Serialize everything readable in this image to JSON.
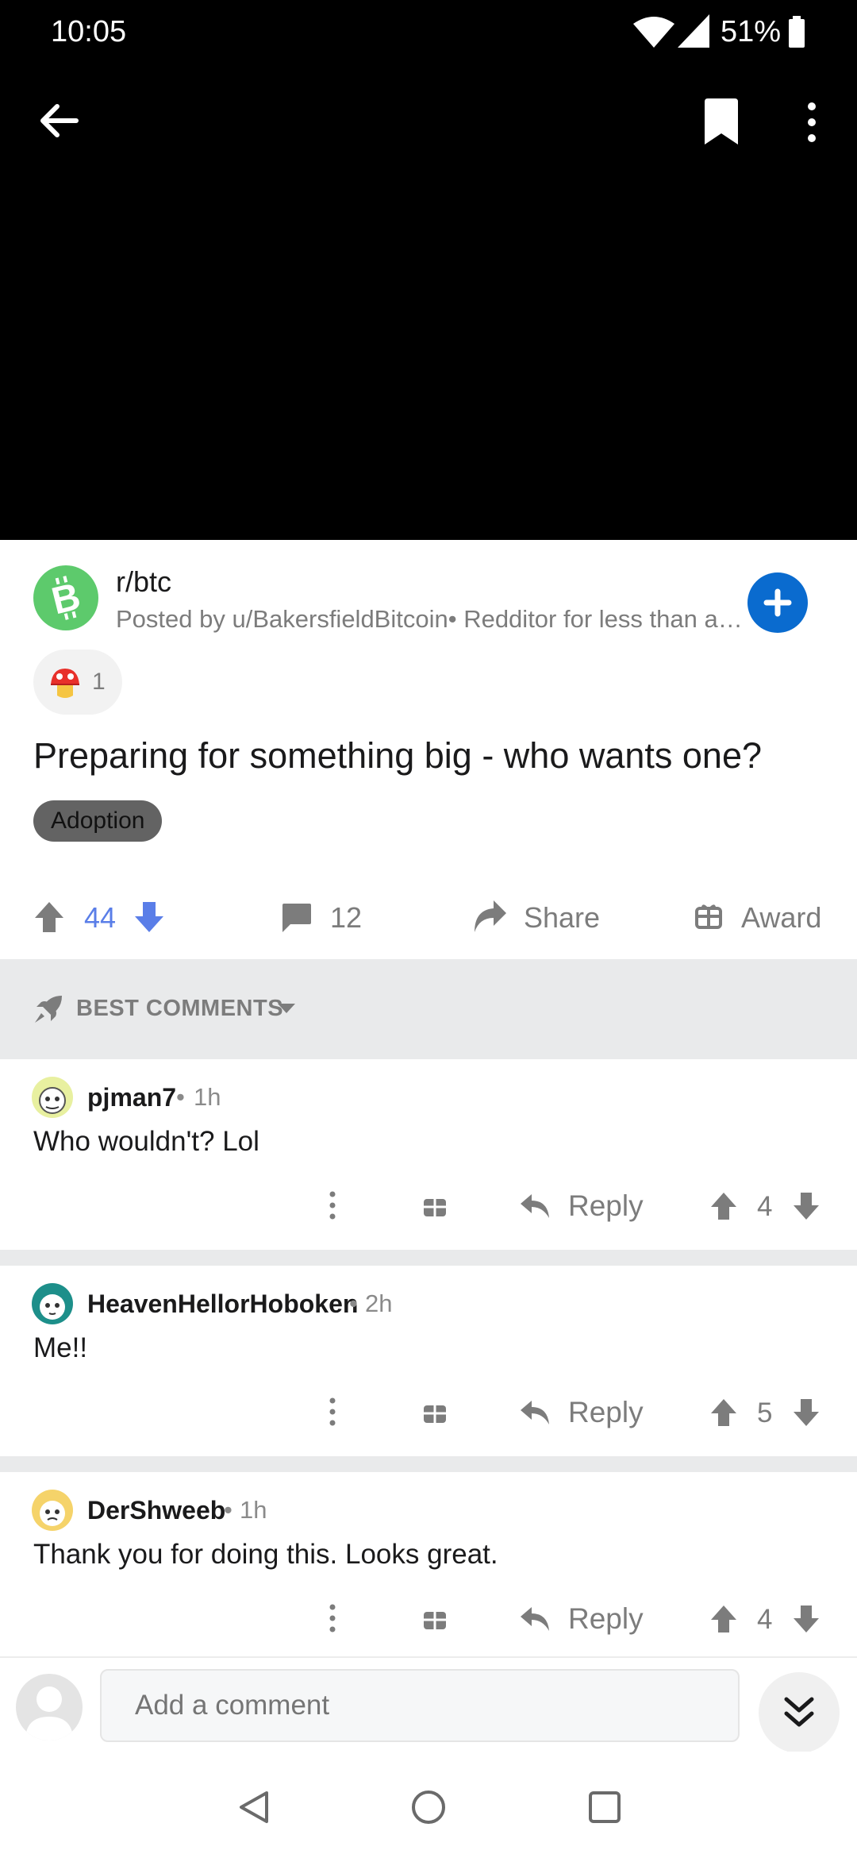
{
  "status_bar": {
    "time": "10:05",
    "battery": "51%"
  },
  "toolbar": {
    "back_icon": "arrow-left-icon",
    "bookmark_icon": "bookmark-icon",
    "more_icon": "more-vertical-icon"
  },
  "post": {
    "subreddit": "r/btc",
    "subreddit_icon": "bitcoin-cash-icon",
    "posted_by": "Posted by u/BakersfieldBitcoin• Redditor for less than a year",
    "award_count": "1",
    "title": "Preparing for something big - who wants one?",
    "flair": "Adoption",
    "votes": "44",
    "comments": "12",
    "share_label": "Share",
    "award_label": "Award"
  },
  "sort": {
    "label": "BEST COMMENTS"
  },
  "comments": [
    {
      "user": "pjman7",
      "time": "1h",
      "body": "Who wouldn't? Lol",
      "reply_label": "Reply",
      "score": "4"
    },
    {
      "user": "HeavenHellorHoboken",
      "time": "2h",
      "body": "Me!!",
      "reply_label": "Reply",
      "score": "5"
    },
    {
      "user": "DerShweeb",
      "time": "1h",
      "body": "Thank you for doing this. Looks great.",
      "reply_label": "Reply",
      "score": "4"
    }
  ],
  "comment_input": {
    "placeholder": "Add a comment"
  },
  "colors": {
    "accent_blue": "#0a6bcf",
    "vote_blue": "#5a7ee8",
    "subreddit_green": "#5dca6c"
  }
}
